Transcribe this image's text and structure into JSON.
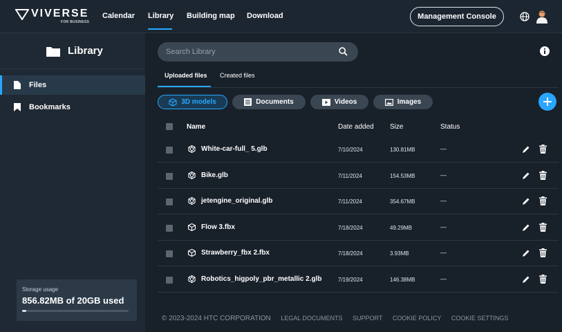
{
  "brand": {
    "name": "VIVERSE",
    "sub": "FOR BUSINESS"
  },
  "nav": {
    "calendar": "Calendar",
    "library": "Library",
    "building_map": "Building map",
    "download": "Download"
  },
  "header": {
    "management_console": "Management Console",
    "globe_icon": "globe-icon",
    "avatar_icon": "user-avatar-icon"
  },
  "sidebar": {
    "title": "Library",
    "items": [
      {
        "label": "Files",
        "icon": "file-icon",
        "active": true
      },
      {
        "label": "Bookmarks",
        "icon": "bookmark-icon",
        "active": false
      }
    ],
    "storage": {
      "label": "Storage usage",
      "value": "856.82MB of 20GB used",
      "fraction": 0.04
    }
  },
  "search": {
    "placeholder": "Search Library"
  },
  "tabs": {
    "uploaded": "Uploaded files",
    "created": "Created files"
  },
  "filters": {
    "models": "3D models",
    "documents": "Documents",
    "videos": "Videos",
    "images": "Images"
  },
  "table": {
    "headers": {
      "name": "Name",
      "date": "Date added",
      "size": "Size",
      "status": "Status"
    },
    "rows": [
      {
        "name": "White-car-full_ 5.glb",
        "date": "7/10/2024",
        "size": "130.81MB",
        "status": "—",
        "icon": "glb-model-icon"
      },
      {
        "name": "Bike.glb",
        "date": "7/11/2024",
        "size": "154.53MB",
        "status": "—",
        "icon": "glb-model-icon"
      },
      {
        "name": "jetengine_original.glb",
        "date": "7/11/2024",
        "size": "354.67MB",
        "status": "—",
        "icon": "glb-model-icon"
      },
      {
        "name": "Flow 3.fbx",
        "date": "7/18/2024",
        "size": "49.29MB",
        "status": "—",
        "icon": "fbx-model-icon"
      },
      {
        "name": "Strawberry_fbx 2.fbx",
        "date": "7/18/2024",
        "size": "3.93MB",
        "status": "—",
        "icon": "fbx-model-icon"
      },
      {
        "name": "Robotics_higpoly_pbr_metallic 2.glb",
        "date": "7/19/2024",
        "size": "146.38MB",
        "status": "—",
        "icon": "glb-model-icon"
      }
    ]
  },
  "footer": {
    "copyright": "© 2023-2024 HTC CORPORATION",
    "legal": "LEGAL DOCUMENTS",
    "support": "SUPPORT",
    "cookie_policy": "COOKIE POLICY",
    "cookie_settings": "COOKIE SETTINGS"
  },
  "colors": {
    "accent": "#27a8ff",
    "background": "#18202a",
    "sidebar": "#1f2933"
  }
}
